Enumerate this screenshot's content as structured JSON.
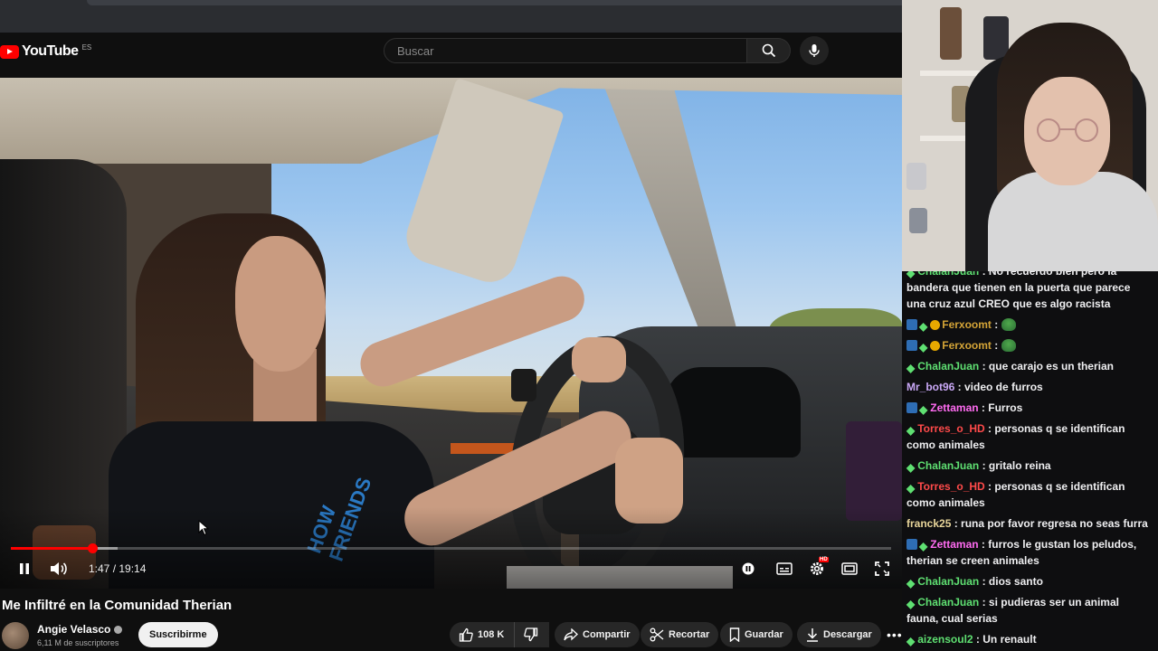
{
  "youtube": {
    "logo_text": "YouTube",
    "country_code": "ES",
    "search_placeholder": "Buscar",
    "player": {
      "time_display": "1:47 / 19:14",
      "progress_fraction": 0.0928,
      "buffer_fraction": 0.121,
      "hd_badge": "HD"
    },
    "video_title": "Me Infiltré en la Comunidad Therian",
    "channel": {
      "name": "Angie Velasco",
      "subscribers": "6,11 M de suscriptores",
      "subscribe_label": "Suscribirme"
    },
    "actions": {
      "likes": "108 K",
      "share": "Compartir",
      "clip": "Recortar",
      "save": "Guardar",
      "download": "Descargar"
    },
    "shirt_text": "HOW FRIENDS"
  },
  "chat": {
    "messages": [
      {
        "user": "ChalanJuan",
        "text": ": No recuerdo bien pero la bandera que tienen en la puerta que parece una cruz azul CREO que es algo racista",
        "color": "#5fe072",
        "badges": [
          "sub"
        ],
        "clipped": true
      },
      {
        "user": "Ferxoomt",
        "text": ": ",
        "color": "#d4a437",
        "badges": [
          "mod",
          "sub",
          "bits"
        ],
        "emote": true
      },
      {
        "user": "Ferxoomt",
        "text": ": ",
        "color": "#d4a437",
        "badges": [
          "mod",
          "sub",
          "bits"
        ],
        "emote": true
      },
      {
        "user": "ChalanJuan",
        "text": ": que carajo es un therian",
        "color": "#5fe072",
        "badges": [
          "sub"
        ]
      },
      {
        "user": "Mr_bot96",
        "text": ": video de furros",
        "color": "#c8a7f5",
        "badges": []
      },
      {
        "user": "Zettaman",
        "text": ": Furros",
        "color": "#ff6bf1",
        "badges": [
          "mod",
          "sub"
        ]
      },
      {
        "user": "Torres_o_HD",
        "text": ": personas q se identifican como animales",
        "color": "#ff4a4a",
        "badges": [
          "sub"
        ]
      },
      {
        "user": "ChalanJuan",
        "text": ": gritalo reina",
        "color": "#5fe072",
        "badges": [
          "sub"
        ]
      },
      {
        "user": "Torres_o_HD",
        "text": ": personas q se identifican como animales",
        "color": "#ff4a4a",
        "badges": [
          "sub"
        ]
      },
      {
        "user": "franck25",
        "text": ": runa por favor regresa no seas furra",
        "color": "#e8d59a",
        "badges": []
      },
      {
        "user": "Zettaman",
        "text": ": furros le gustan los peludos, therian se creen animales",
        "color": "#ff6bf1",
        "badges": [
          "mod",
          "sub"
        ]
      },
      {
        "user": "ChalanJuan",
        "text": ": dios santo",
        "color": "#5fe072",
        "badges": [
          "sub"
        ]
      },
      {
        "user": "ChalanJuan",
        "text": ": si pudieras ser un animal fauna, cual serias",
        "color": "#5fe072",
        "badges": [
          "sub"
        ]
      },
      {
        "user": "aizensoul2",
        "text": ": Un renault",
        "color": "#5fe072",
        "badges": [
          "sub"
        ]
      }
    ]
  }
}
